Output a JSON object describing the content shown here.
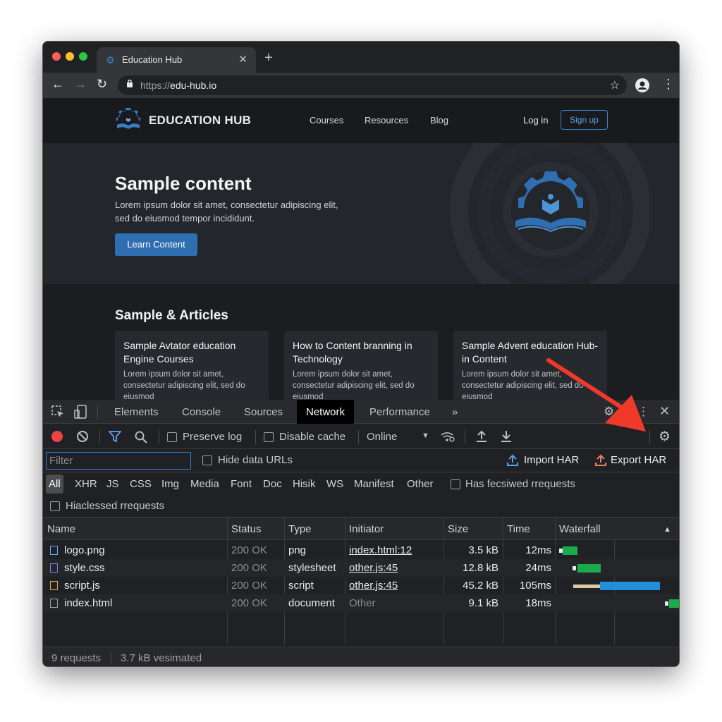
{
  "browser": {
    "tab_title": "Education Hub",
    "url_scheme": "https://",
    "url_host": "edu-hub.io"
  },
  "site": {
    "brand": "EDUCATION HUB",
    "nav": [
      "Courses",
      "Resources",
      "Blog"
    ],
    "login": "Log in",
    "signup": "Sign up",
    "hero_title": "Sample content",
    "hero_text": "Lorem ipsum dolor sit amet, consectetur adipiscing elit, sed do eiusmod tempor incididunt.",
    "hero_button": "Learn Content",
    "articles_title": "Sample & Articles",
    "cards": [
      {
        "title": "Sample Avtator education Engine Courses",
        "text": "Lorem ipsum dolor sit amet, consectetur adipiscing elit, sed do eiusmod"
      },
      {
        "title": "How to Content branning in Technology",
        "text": "Lorem ipsum dolor sit amet, consectetur adipiscing elit, sed do eiusmod"
      },
      {
        "title": "Sample Advent education Hub-in Content",
        "text": "Lorem ipsum dolor sit amet, consectetur adipiscing elit, sed do eiusmod"
      }
    ]
  },
  "devtools": {
    "tabs": [
      "Elements",
      "Console",
      "Sources",
      "Network",
      "Performance"
    ],
    "active_tab": "Network",
    "more_tabs": "»",
    "preserve_log": "Preserve log",
    "disable_cache": "Disable cache",
    "throttling": "Online",
    "filter_placeholder": "Filter",
    "hide_data_urls": "Hide data URLs",
    "import_har": "Import HAR",
    "export_har": "Export HAR",
    "types": [
      "All",
      "XHR",
      "JS",
      "CSS",
      "Img",
      "Media",
      "Font",
      "Doc",
      "Hisik",
      "WS",
      "Manifest",
      "Other"
    ],
    "has_requests": "Has fecsiwed rrequests",
    "blocked_requests": "Hiaclessed rrequests",
    "columns": [
      "Name",
      "Status",
      "Type",
      "Initiator",
      "Size",
      "Time",
      "Waterfall"
    ],
    "rows": [
      {
        "name": "logo.png",
        "status": "200 OK",
        "type": "png",
        "initiator": "index.html:12",
        "size": "3.5 kB",
        "time": "12ms",
        "color": "#1aab4b"
      },
      {
        "name": "style.css",
        "status": "200 OK",
        "type": "stylesheet",
        "initiator": "other.js:45",
        "size": "12.8 kB",
        "time": "24ms",
        "color": "#1aab4b"
      },
      {
        "name": "script.js",
        "status": "200 OK",
        "type": "script",
        "initiator": "other.js:45",
        "size": "45.2 kB",
        "time": "105ms",
        "color": "#1f8fd8"
      },
      {
        "name": "index.html",
        "status": "200 OK",
        "type": "document",
        "initiator": "Other",
        "size": "9.1 kB",
        "time": "18ms",
        "color": "#1aab4b"
      }
    ],
    "status_requests": "9 requests",
    "status_transferred": "3.7 kB vesimated"
  },
  "colors": {
    "accent": "#2f6eb0",
    "record": "#ee4444",
    "arrow": "#f0392b",
    "waterfall_green": "#1aab4b",
    "waterfall_blue": "#1f8fd8"
  }
}
